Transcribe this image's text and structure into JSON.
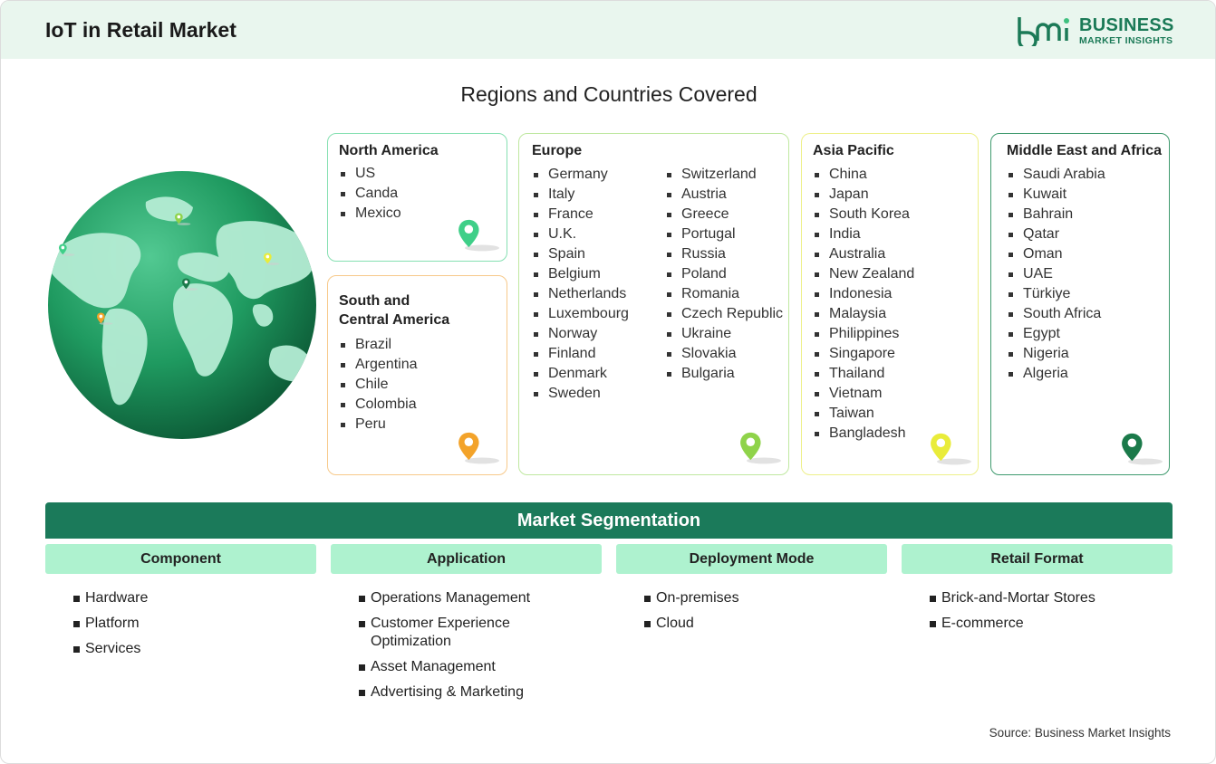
{
  "header": {
    "title": "IoT in Retail Market"
  },
  "logo": {
    "line1": "BUSINESS",
    "line2": "MARKET INSIGHTS",
    "brand_color": "#1b7a57"
  },
  "regions_title": "Regions and Countries Covered",
  "regions": {
    "north_america": {
      "name": "North America",
      "countries": [
        "US",
        "Canda",
        "Mexico"
      ],
      "pin_color": "#3fcf88"
    },
    "south_america": {
      "name_line1": "South and",
      "name_line2": "Central America",
      "countries": [
        "Brazil",
        "Argentina",
        "Chile",
        "Colombia",
        "Peru"
      ],
      "pin_color": "#f3a32a"
    },
    "europe": {
      "name": "Europe",
      "countries_col1": [
        "Germany",
        "Italy",
        "France",
        "U.K.",
        "Spain",
        "Belgium",
        "Netherlands",
        "Luxembourg",
        "Norway",
        "Finland",
        "Denmark",
        "Sweden"
      ],
      "countries_col2": [
        "Switzerland",
        "Austria",
        "Greece",
        "Portugal",
        "Russia",
        "Poland",
        "Romania",
        "Czech Republic",
        "Ukraine",
        "Slovakia",
        "Bulgaria"
      ],
      "pin_color": "#8fd34a"
    },
    "asia_pacific": {
      "name": "Asia Pacific",
      "countries": [
        "China",
        "Japan",
        "South Korea",
        "India",
        "Australia",
        "New Zealand",
        "Indonesia",
        "Malaysia",
        "Philippines",
        "Singapore",
        "Thailand",
        "Vietnam",
        "Taiwan",
        "Bangladesh"
      ],
      "pin_color": "#e9ec3a"
    },
    "mea": {
      "name": "Middle East and Africa",
      "countries": [
        "Saudi Arabia",
        "Kuwait",
        "Bahrain",
        "Qatar",
        "Oman",
        "UAE",
        "Türkiye",
        "South Africa",
        "Egypt",
        "Nigeria",
        "Algeria"
      ],
      "pin_color": "#1b7a4a"
    }
  },
  "segmentation": {
    "title": "Market Segmentation",
    "component": {
      "label": "Component",
      "items": [
        "Hardware",
        "Platform",
        "Services"
      ]
    },
    "application": {
      "label": "Application",
      "items": [
        "Operations Management",
        "Customer Experience Optimization",
        "Asset Management",
        "Advertising & Marketing"
      ]
    },
    "deployment": {
      "label": "Deployment Mode",
      "items": [
        "On-premises",
        "Cloud"
      ]
    },
    "retail_format": {
      "label": "Retail Format",
      "items": [
        "Brick-and-Mortar Stores",
        "E-commerce"
      ]
    }
  },
  "source": "Source: Business Market Insights"
}
